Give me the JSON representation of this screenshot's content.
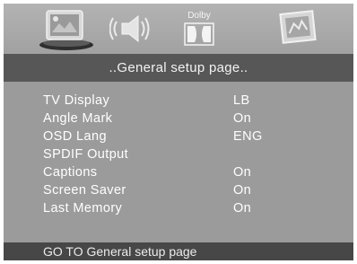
{
  "icon_bar": {
    "tabs": [
      {
        "name": "general-setup",
        "icon": "tv-display-icon",
        "active": true
      },
      {
        "name": "audio-setup",
        "icon": "speaker-icon",
        "active": false
      },
      {
        "name": "dolby-setup",
        "icon": "dolby-icon",
        "label": "Dolby",
        "active": false
      },
      {
        "name": "preference-setup",
        "icon": "preference-page-icon",
        "active": false
      }
    ]
  },
  "title": "..General setup page..",
  "menu": [
    {
      "label": "TV Display",
      "value": "LB"
    },
    {
      "label": "Angle Mark",
      "value": "On"
    },
    {
      "label": "OSD Lang",
      "value": "ENG"
    },
    {
      "label": "SPDIF Output",
      "value": ""
    },
    {
      "label": "Captions",
      "value": "On"
    },
    {
      "label": "Screen Saver",
      "value": "On"
    },
    {
      "label": "Last Memory",
      "value": "On"
    }
  ],
  "status": "GO TO General setup page"
}
